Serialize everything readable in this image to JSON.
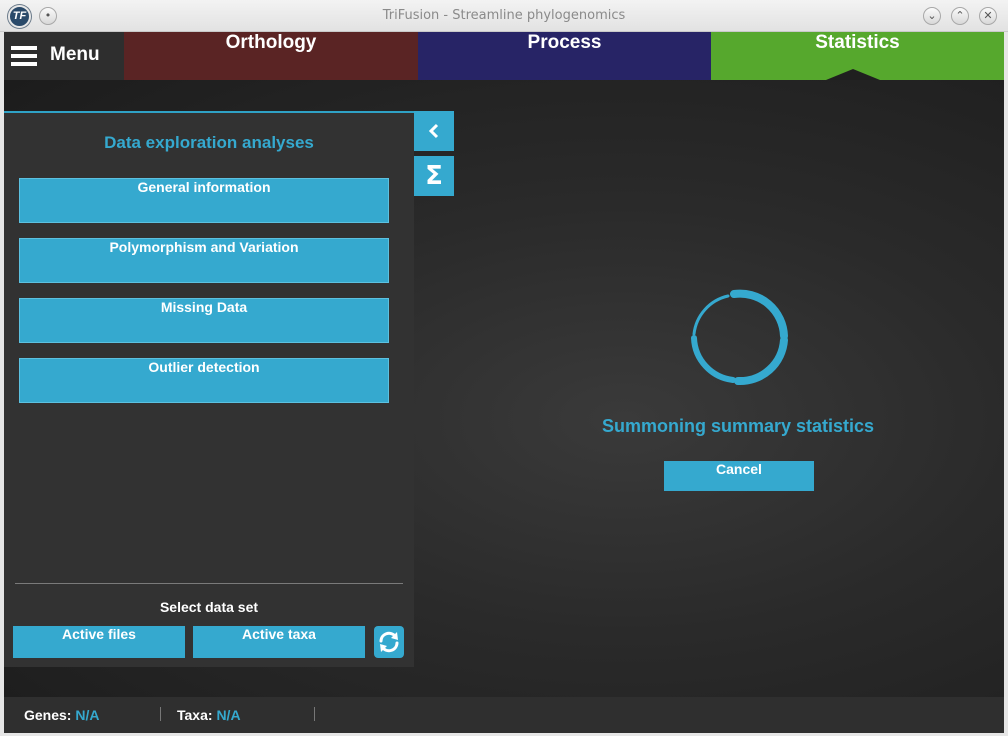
{
  "window": {
    "title": "TriFusion - Streamline phylogenomics",
    "logo_text": "TF",
    "icons": {
      "app": "trifusion-logo-icon",
      "minimize": "chevron-down-icon",
      "maximize": "chevron-up-icon",
      "close": "close-icon"
    }
  },
  "nav": {
    "menu_label": "Menu",
    "tabs": [
      {
        "label": "Orthology",
        "color": "#5a2424"
      },
      {
        "label": "Process",
        "color": "#272466"
      },
      {
        "label": "Statistics",
        "color": "#56a82d"
      }
    ]
  },
  "panel": {
    "title": "Data exploration analyses",
    "buttons": [
      {
        "label": "General information"
      },
      {
        "label": "Polymorphism and Variation"
      },
      {
        "label": "Missing Data"
      },
      {
        "label": "Outlier detection"
      }
    ],
    "select_label": "Select data set",
    "active_files_label": "Active files",
    "active_taxa_label": "Active taxa"
  },
  "side_buttons": {
    "collapse_glyph": "‹",
    "sigma_glyph": "Σ"
  },
  "loading": {
    "message": "Summoning summary statistics",
    "cancel_label": "Cancel"
  },
  "footer": {
    "genes_label": "Genes:",
    "genes_value": "N/A",
    "taxa_label": "Taxa:",
    "taxa_value": "N/A"
  },
  "colors": {
    "accent": "#35a9cf",
    "background": "#2b2b2b"
  }
}
